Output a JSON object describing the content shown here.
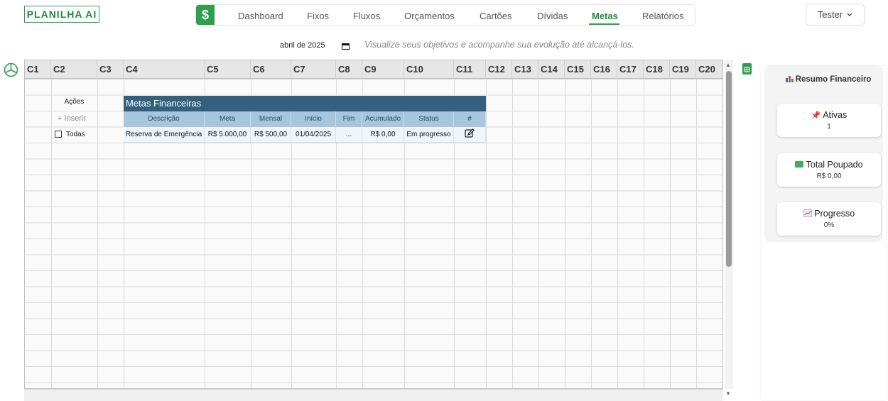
{
  "app": {
    "logo": "PLANILHA AI"
  },
  "nav": {
    "dollar_symbol": "$",
    "tabs": [
      {
        "label": "Dashboard"
      },
      {
        "label": "Fixos"
      },
      {
        "label": "Fluxos"
      },
      {
        "label": "Orçamentos"
      },
      {
        "label": "Cartões"
      },
      {
        "label": "Dívidas"
      },
      {
        "label": "Metas",
        "active": true
      },
      {
        "label": "Relatórios"
      }
    ]
  },
  "user": {
    "name": "Tester"
  },
  "toolbar": {
    "month": "abril de 2025",
    "subtitle": "Visualize seus objetivos e acompanhe sua evolução até alcançá-los."
  },
  "sheet": {
    "columns": [
      "C1",
      "C2",
      "C3",
      "C4",
      "C5",
      "C6",
      "C7",
      "C8",
      "C9",
      "C10",
      "C11",
      "C12",
      "C13",
      "C14",
      "C15",
      "C16",
      "C17",
      "C18",
      "C19",
      "C20"
    ],
    "actions_label": "Ações",
    "insert_label": "+ Inserir",
    "all_label": "Todas",
    "table_title": "Metas Financeiras",
    "table_headers": [
      "Descrição",
      "Meta",
      "Mensal",
      "Início",
      "Fim",
      "Acumulado",
      "Status",
      "#"
    ],
    "rows": [
      {
        "descricao": "Reserva de Emergência",
        "meta": "R$ 5.000,00",
        "mensal": "R$ 500,00",
        "inicio": "01/04/2025",
        "fim": "...",
        "acumulado": "R$ 0,00",
        "status": "Em progresso"
      }
    ]
  },
  "summary": {
    "title": "Resumo Financeiro",
    "cards": [
      {
        "label": "Ativas",
        "value": "1",
        "icon": "pushpin-icon"
      },
      {
        "label": "Total Poupado",
        "value": "R$ 0,00",
        "icon": "money-icon"
      },
      {
        "label": "Progresso",
        "value": "0%",
        "icon": "trend-chart-icon"
      }
    ]
  },
  "colors": {
    "brand_green": "#2e9e4f",
    "table_header": "#33607f",
    "table_subheader": "#a7c6dd"
  }
}
